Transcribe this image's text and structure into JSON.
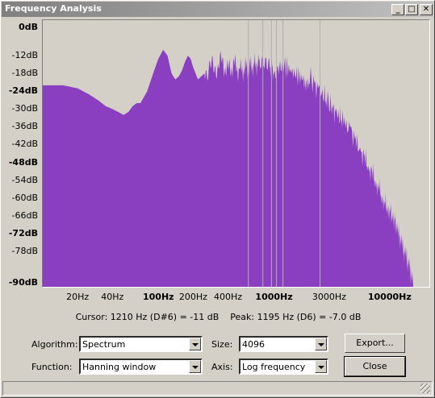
{
  "window": {
    "title": "Frequency Analysis"
  },
  "title_buttons": {
    "minimize": "_",
    "maximize": "□",
    "close": "✕"
  },
  "chart_data": {
    "type": "area",
    "xscale": "log",
    "xlim": [
      10,
      22050
    ],
    "ylim": [
      -90,
      0
    ],
    "fill_color": "#8a3fc0",
    "y_ticks": [
      {
        "label": "0dB",
        "value": 0,
        "bold": true
      },
      {
        "label": "-12dB",
        "value": -12,
        "bold": false
      },
      {
        "label": "-18dB",
        "value": -18,
        "bold": false
      },
      {
        "label": "-24dB",
        "value": -24,
        "bold": true
      },
      {
        "label": "-30dB",
        "value": -30,
        "bold": false
      },
      {
        "label": "-36dB",
        "value": -36,
        "bold": false
      },
      {
        "label": "-42dB",
        "value": -42,
        "bold": false
      },
      {
        "label": "-48dB",
        "value": -48,
        "bold": true
      },
      {
        "label": "-54dB",
        "value": -54,
        "bold": false
      },
      {
        "label": "-60dB",
        "value": -60,
        "bold": false
      },
      {
        "label": "-66dB",
        "value": -66,
        "bold": false
      },
      {
        "label": "-72dB",
        "value": -72,
        "bold": true
      },
      {
        "label": "-78dB",
        "value": -78,
        "bold": false
      },
      {
        "label": "-90dB",
        "value": -90,
        "bold": true
      }
    ],
    "x_ticks": [
      {
        "label": "20Hz",
        "value": 20,
        "bold": false
      },
      {
        "label": "40Hz",
        "value": 40,
        "bold": false
      },
      {
        "label": "100Hz",
        "value": 100,
        "bold": true
      },
      {
        "label": "200Hz",
        "value": 200,
        "bold": false
      },
      {
        "label": "400Hz",
        "value": 400,
        "bold": false
      },
      {
        "label": "1000Hz",
        "value": 1000,
        "bold": true
      },
      {
        "label": "3000Hz",
        "value": 3000,
        "bold": false
      },
      {
        "label": "10000Hz",
        "value": 10000,
        "bold": true
      }
    ],
    "spectrum": {
      "x": [
        10,
        12,
        15,
        20,
        25,
        30,
        35,
        40,
        45,
        50,
        55,
        60,
        65,
        70,
        80,
        90,
        100,
        110,
        120,
        130,
        140,
        150,
        160,
        170,
        180,
        190,
        200,
        220,
        250,
        280,
        300,
        350,
        400,
        450,
        500,
        600,
        700,
        800,
        900,
        1000,
        1200,
        1500,
        1800,
        2000,
        2500,
        3000,
        3500,
        4000,
        5000,
        6000,
        7000,
        8000,
        9000,
        10000,
        11000,
        12000,
        13000,
        14000,
        15000,
        16000
      ],
      "y": [
        -22,
        -22,
        -22,
        -23,
        -25,
        -27,
        -29,
        -30,
        -31,
        -32,
        -31,
        -29,
        -28,
        -28,
        -24,
        -18,
        -13,
        -10,
        -12,
        -18,
        -20,
        -19,
        -17,
        -14,
        -12,
        -13,
        -16,
        -20,
        -18,
        -15,
        -17,
        -14,
        -17,
        -15,
        -17,
        -16,
        -15,
        -14,
        -15,
        -17,
        -15,
        -18,
        -20,
        -19,
        -24,
        -28,
        -32,
        -34,
        -40,
        -46,
        -51,
        -56,
        -61,
        -64,
        -67,
        -72,
        -77,
        -81,
        -85,
        -90
      ]
    },
    "peak_lines_hz": [
      600,
      800,
      950,
      1050,
      1195,
      2500
    ]
  },
  "readout": {
    "cursor": "Cursor: 1210 Hz (D#6) = -11 dB",
    "peak": "Peak: 1195 Hz (D6) = -7.0 dB"
  },
  "controls": {
    "algorithm_label": "Algorithm:",
    "algorithm_value": "Spectrum",
    "function_label": "Function:",
    "function_value": "Hanning window",
    "size_label": "Size:",
    "size_value": "4096",
    "axis_label": "Axis:",
    "axis_value": "Log frequency",
    "export_label": "Export...",
    "close_label": "Close"
  }
}
